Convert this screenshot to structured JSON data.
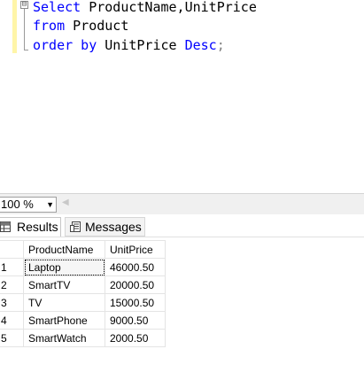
{
  "editor": {
    "collapse_glyph": "⊟",
    "lines": [
      {
        "kw1": "Select",
        "rest": " ProductName,UnitPrice",
        "kw2": "",
        "tail": ""
      },
      {
        "kw1": "from",
        "rest": " Product",
        "kw2": "",
        "tail": ""
      },
      {
        "kw1": "order by",
        "rest": " UnitPrice ",
        "kw2": "Desc",
        "tail": ";"
      }
    ]
  },
  "zoom": {
    "value": "100 %",
    "dropdown_glyph": "▼",
    "scroll_left_glyph": "◀"
  },
  "tabs": {
    "results": "Results",
    "messages": "Messages"
  },
  "grid": {
    "columns": [
      "",
      "ProductName",
      "UnitPrice"
    ],
    "rows": [
      {
        "idx": "1",
        "name": "Laptop",
        "price": "46000.50"
      },
      {
        "idx": "2",
        "name": "SmartTV",
        "price": "20000.50"
      },
      {
        "idx": "3",
        "name": "TV",
        "price": "15000.50"
      },
      {
        "idx": "4",
        "name": "SmartPhone",
        "price": "9000.50"
      },
      {
        "idx": "5",
        "name": "SmartWatch",
        "price": "2000.50"
      }
    ]
  },
  "colors": {
    "keyword": "#0000ff",
    "change_bar": "#fff5a8",
    "tab_active_bg": "#ffffff"
  }
}
